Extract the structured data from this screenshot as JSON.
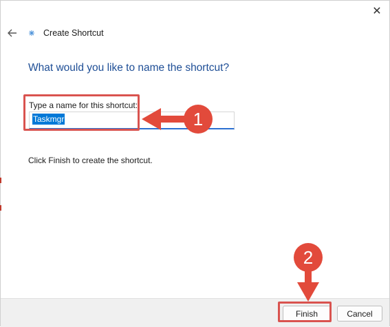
{
  "window": {
    "title": "Create Shortcut",
    "close_glyph": "✕",
    "back_glyph": "←"
  },
  "main": {
    "heading": "What would you like to name the shortcut?",
    "name_label": "Type a name for this shortcut:",
    "name_value": "Taskmgr",
    "hint": "Click Finish to create the shortcut."
  },
  "footer": {
    "finish_label": "Finish",
    "cancel_label": "Cancel"
  },
  "annotations": {
    "step1": "1",
    "step2": "2",
    "color": "#e24a3b"
  },
  "icons": {
    "close": "close-icon",
    "back": "back-arrow-icon",
    "app": "shortcut-app-icon"
  }
}
